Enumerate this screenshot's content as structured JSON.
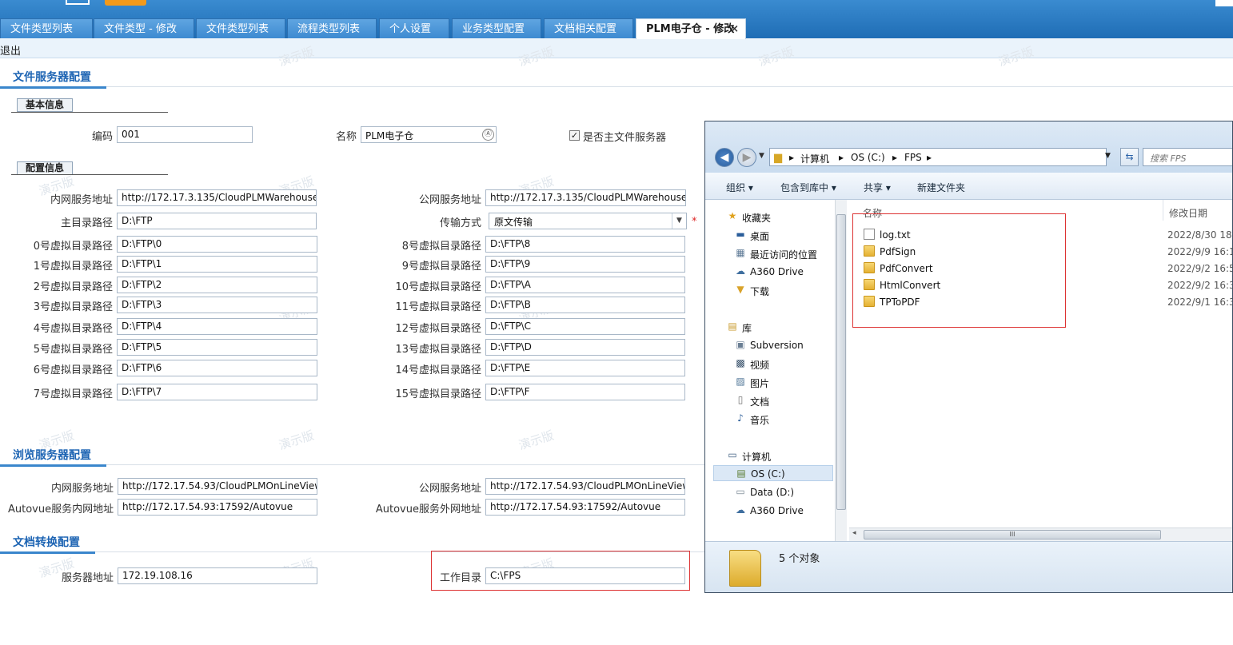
{
  "header": {
    "tabs": [
      {
        "label": "文件类型列表"
      },
      {
        "label": "文件类型 - 修改"
      },
      {
        "label": "文件类型列表"
      },
      {
        "label": "流程类型列表"
      },
      {
        "label": "个人设置"
      },
      {
        "label": "业务类型配置"
      },
      {
        "label": "文档相关配置"
      },
      {
        "label": "PLM电子仓 - 修改",
        "active": true
      }
    ],
    "close_glyph": "×",
    "exit_label": "退出",
    "watermark": "演示版",
    "colors": {
      "header_blue": "#2b7bc4",
      "accent_orange": "#f39a1b"
    }
  },
  "file_server": {
    "title": "文件服务器配置",
    "basic": {
      "title": "基本信息",
      "code_label": "编码",
      "code_value": "001",
      "name_label": "名称",
      "name_value": "PLM电子仓",
      "is_main_label": "是否主文件服务器",
      "is_main_checked": true
    },
    "config": {
      "title": "配置信息",
      "lan_label": "内网服务地址",
      "lan_value": "http://172.17.3.135/CloudPLMWarehouse",
      "wan_label": "公网服务地址",
      "wan_value": "http://172.17.3.135/CloudPLMWarehouse",
      "root_label": "主目录路径",
      "root_value": "D:\\FTP",
      "transfer_label": "传输方式",
      "transfer_value": "原文传输",
      "required_mark": "*",
      "vpaths_left": [
        {
          "label": "0号虚拟目录路径",
          "value": "D:\\FTP\\0"
        },
        {
          "label": "1号虚拟目录路径",
          "value": "D:\\FTP\\1"
        },
        {
          "label": "2号虚拟目录路径",
          "value": "D:\\FTP\\2"
        },
        {
          "label": "3号虚拟目录路径",
          "value": "D:\\FTP\\3"
        },
        {
          "label": "4号虚拟目录路径",
          "value": "D:\\FTP\\4"
        },
        {
          "label": "5号虚拟目录路径",
          "value": "D:\\FTP\\5"
        },
        {
          "label": "6号虚拟目录路径",
          "value": "D:\\FTP\\6"
        },
        {
          "label": "7号虚拟目录路径",
          "value": "D:\\FTP\\7"
        }
      ],
      "vpaths_right": [
        {
          "label": "8号虚拟目录路径",
          "value": "D:\\FTP\\8"
        },
        {
          "label": "9号虚拟目录路径",
          "value": "D:\\FTP\\9"
        },
        {
          "label": "10号虚拟目录路径",
          "value": "D:\\FTP\\A"
        },
        {
          "label": "11号虚拟目录路径",
          "value": "D:\\FTP\\B"
        },
        {
          "label": "12号虚拟目录路径",
          "value": "D:\\FTP\\C"
        },
        {
          "label": "13号虚拟目录路径",
          "value": "D:\\FTP\\D"
        },
        {
          "label": "14号虚拟目录路径",
          "value": "D:\\FTP\\E"
        },
        {
          "label": "15号虚拟目录路径",
          "value": "D:\\FTP\\F"
        }
      ]
    }
  },
  "preview_server": {
    "title": "浏览服务器配置",
    "lan_label": "内网服务地址",
    "lan_value": "http://172.17.54.93/CloudPLMOnLineView",
    "wan_label": "公网服务地址",
    "wan_value": "http://172.17.54.93/CloudPLMOnLineView",
    "av_lan_label": "Autovue服务内网地址",
    "av_lan_value": "http://172.17.54.93:17592/Autovue",
    "av_wan_label": "Autovue服务外网地址",
    "av_wan_value": "http://172.17.54.93:17592/Autovue"
  },
  "convert": {
    "title": "文档转换配置",
    "server_label": "服务器地址",
    "server_value": "172.19.108.16",
    "workdir_label": "工作目录",
    "workdir_value": "C:\\FPS"
  },
  "explorer": {
    "crumbs": [
      "计算机",
      "OS (C:)",
      "FPS"
    ],
    "search_placeholder": "搜索 FPS",
    "commands": {
      "organize": "组织",
      "include": "包含到库中",
      "share": "共享",
      "new_folder": "新建文件夹"
    },
    "nav": {
      "favorites": "收藏夹",
      "desktop": "桌面",
      "recent": "最近访问的位置",
      "a360": "A360 Drive",
      "downloads": "下载",
      "library": "库",
      "subversion": "Subversion",
      "video": "视频",
      "pictures": "图片",
      "docs": "文档",
      "music": "音乐",
      "computer": "计算机",
      "os_c": "OS (C:)",
      "data_d": "Data (D:)",
      "a360b": "A360 Drive"
    },
    "col_name": "名称",
    "col_date": "修改日期",
    "files": [
      {
        "name": "log.txt",
        "date": "2022/8/30 18:",
        "type": "file"
      },
      {
        "name": "PdfSign",
        "date": "2022/9/9 16:1",
        "type": "folder"
      },
      {
        "name": "PdfConvert",
        "date": "2022/9/2 16:5",
        "type": "folder"
      },
      {
        "name": "HtmlConvert",
        "date": "2022/9/2 16:3",
        "type": "folder"
      },
      {
        "name": "TPToPDF",
        "date": "2022/9/1 16:3",
        "type": "folder"
      }
    ],
    "status": "5 个对象",
    "scroll_grip": "III"
  }
}
